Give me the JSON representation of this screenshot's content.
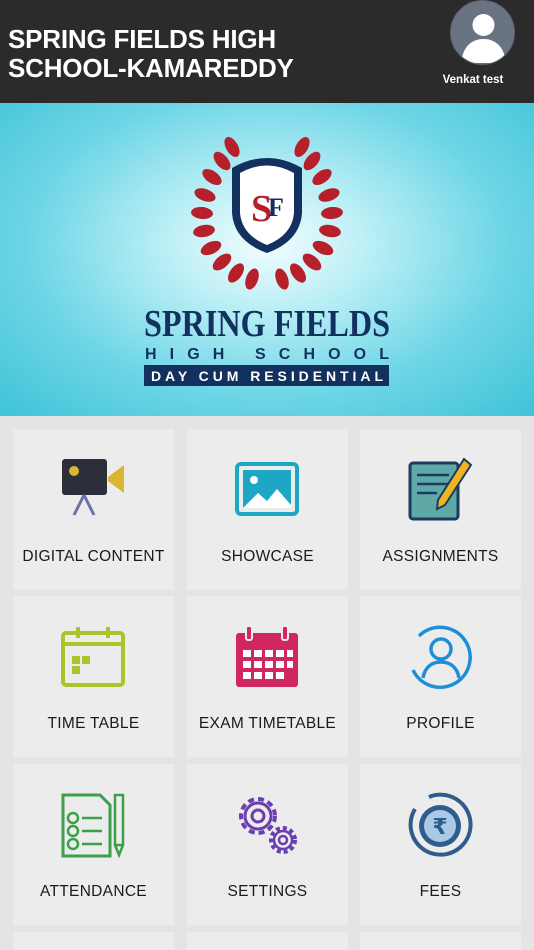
{
  "header": {
    "school_title": "SPRING FIELDS HIGH SCHOOL-KAMAREDDY",
    "user_name": "Venkat test"
  },
  "banner": {
    "monogram_s": "S",
    "monogram_f": "F",
    "logo_line1": "SPRING FIELDS",
    "logo_line2": "HIGH SCHOOL",
    "logo_line3": "DAY CUM RESIDENTIAL"
  },
  "menu": [
    {
      "label": "DIGITAL CONTENT",
      "icon": "video-camera-icon",
      "color": "#d9b531"
    },
    {
      "label": "SHOWCASE",
      "icon": "image-icon",
      "color": "#1ea7c4"
    },
    {
      "label": "ASSIGNMENTS",
      "icon": "document-pencil-icon",
      "color": "#5fa8a8"
    },
    {
      "label": "TIME TABLE",
      "icon": "calendar-icon",
      "color": "#a9c52a"
    },
    {
      "label": "EXAM TIMETABLE",
      "icon": "exam-calendar-icon",
      "color": "#d0285e"
    },
    {
      "label": "PROFILE",
      "icon": "user-circle-icon",
      "color": "#1d8fd8"
    },
    {
      "label": "ATTENDANCE",
      "icon": "checklist-icon",
      "color": "#3aa04a"
    },
    {
      "label": "SETTINGS",
      "icon": "gears-icon",
      "color": "#6a3fb0"
    },
    {
      "label": "FEES",
      "icon": "rupee-coin-icon",
      "color": "#2d5d8a"
    }
  ]
}
